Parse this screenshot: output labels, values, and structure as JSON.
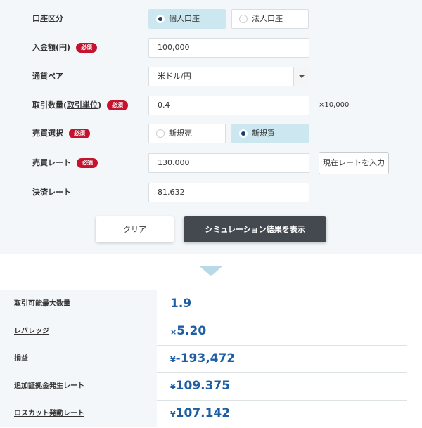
{
  "form": {
    "account_type": {
      "label": "口座区分",
      "options": [
        {
          "label": "個人口座",
          "selected": true
        },
        {
          "label": "法人口座",
          "selected": false
        }
      ]
    },
    "deposit": {
      "label": "入金額(円)",
      "required_badge": "必須",
      "value": "100,000"
    },
    "currency_pair": {
      "label": "通貨ペア",
      "value": "米ドル/円"
    },
    "quantity": {
      "label_prefix": "取引数量(",
      "label_link": "取引単位",
      "label_suffix": ")",
      "required_badge": "必須",
      "value": "0.4",
      "unit_suffix": "×10,000"
    },
    "trade_type": {
      "label": "売買選択",
      "required_badge": "必須",
      "options": [
        {
          "label": "新規売",
          "selected": false
        },
        {
          "label": "新規買",
          "selected": true
        }
      ]
    },
    "trade_rate": {
      "label": "売買レート",
      "required_badge": "必須",
      "value": "130.000",
      "button_label": "現在レートを入力"
    },
    "settlement_rate": {
      "label": "決済レート",
      "value": "81.632"
    }
  },
  "actions": {
    "clear_label": "クリア",
    "submit_label": "シミュレーション結果を表示"
  },
  "results": [
    {
      "label": "取引可能最大数量",
      "prefix": "",
      "value": "1.9",
      "link": false
    },
    {
      "label": "レバレッジ",
      "prefix": "×",
      "value": "5.20",
      "link": true
    },
    {
      "label": "損益",
      "prefix": "¥",
      "value": "-193,472",
      "link": false
    },
    {
      "label": "追加証拠金発生レート",
      "prefix": "¥",
      "value": "109.375",
      "link": false
    },
    {
      "label": "ロスカット発動レート",
      "prefix": "¥",
      "value": "107.142",
      "link": true
    }
  ],
  "colors": {
    "accent": "#1c5da3",
    "required": "#c4122f",
    "selected_bg": "#cde7f0",
    "submit_bg": "#44494f"
  }
}
